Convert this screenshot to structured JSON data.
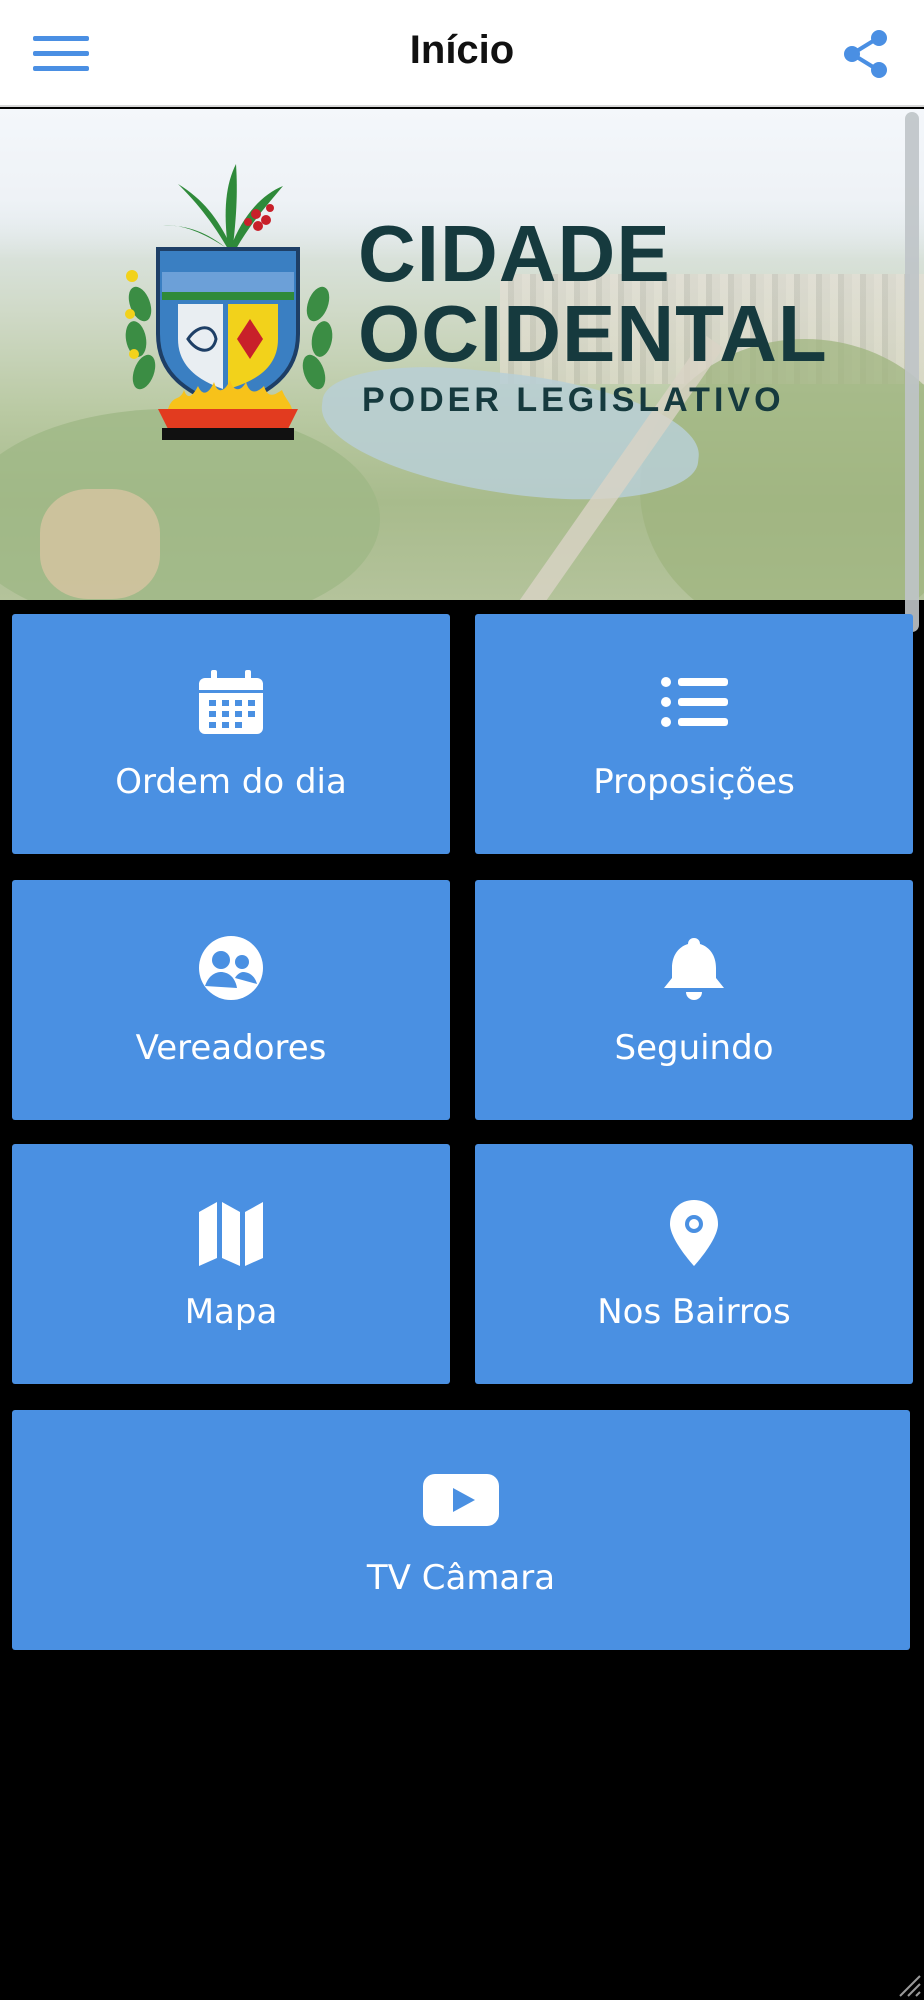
{
  "header": {
    "title": "Início",
    "menu_icon": "hamburger-menu-icon",
    "share_icon": "share-icon",
    "accent_color": "#4a8fe3"
  },
  "banner": {
    "brand_line1": "CIDADE",
    "brand_line2": "OCIDENTAL",
    "brand_subtitle": "PODER LEGISLATIVO",
    "text_color": "#163a3e"
  },
  "tiles": [
    {
      "label": "Ordem do dia",
      "icon": "calendar-icon"
    },
    {
      "label": "Proposições",
      "icon": "list-icon"
    },
    {
      "label": "Vereadores",
      "icon": "users-icon"
    },
    {
      "label": "Seguindo",
      "icon": "bell-icon"
    },
    {
      "label": "Mapa",
      "icon": "map-icon"
    },
    {
      "label": "Nos Bairros",
      "icon": "map-pin-icon"
    },
    {
      "label": "TV Câmara",
      "icon": "youtube-play-icon"
    }
  ],
  "colors": {
    "tile_background": "#4a90e2",
    "page_background": "#000000"
  }
}
